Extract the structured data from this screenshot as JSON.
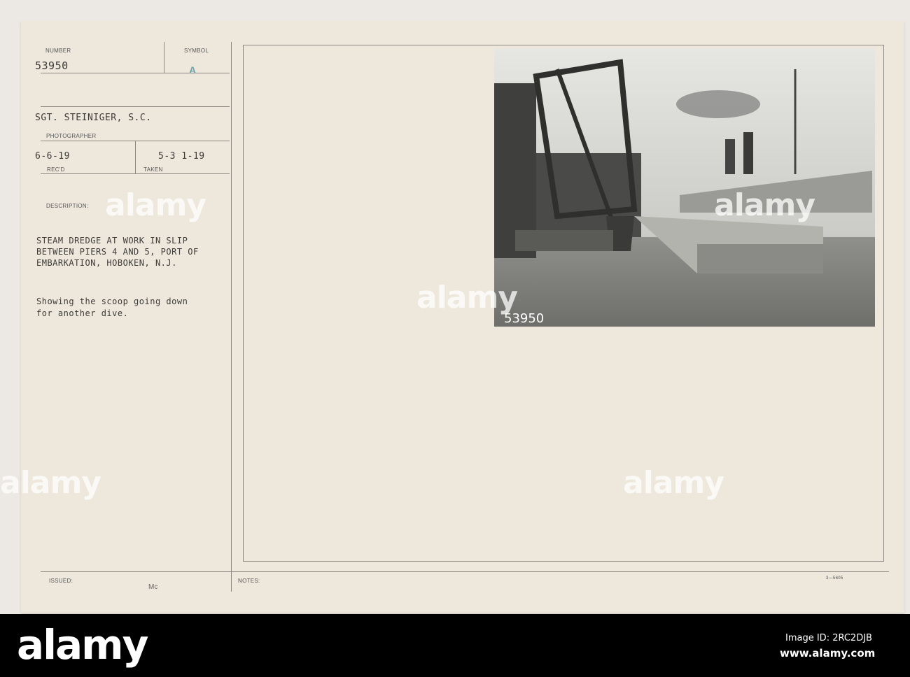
{
  "card": {
    "number_label": "NUMBER",
    "number": "53950",
    "symbol_label": "SYMBOL",
    "symbol": "A",
    "photographer": "SGT. STEINIGER, S.C.",
    "photographer_label": "PHOTOGRAPHER",
    "received": "6-6-19",
    "received_label": "REC'D",
    "taken": "5-3 1-19",
    "taken_label": "TAKEN",
    "description_label": "DESCRIPTION:",
    "description_lines": [
      "STEAM DREDGE AT WORK IN SLIP",
      "BETWEEN PIERS 4 AND 5, PORT OF",
      "EMBARKATION, HOBOKEN, N.J."
    ],
    "note_lines": [
      "Showing the scoop going down",
      "for another dive."
    ],
    "issued_label": "ISSUED:",
    "issued_initials": "Mc",
    "notes_label": "NOTES:",
    "form_number": "3—5605",
    "photo_number": "53950"
  },
  "watermark": "alamy",
  "footer": {
    "logo": "alamy",
    "image_id": "Image ID: 2RC2DJB",
    "url": "www.alamy.com"
  }
}
